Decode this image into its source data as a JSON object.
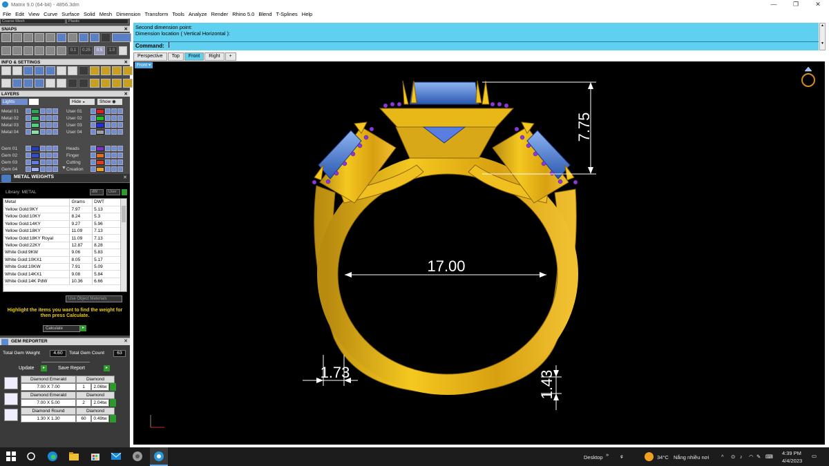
{
  "window": {
    "title": "Matrix 9.0 (64-bit) - 4856.3dm",
    "controls": [
      "—",
      "❐",
      "✕"
    ]
  },
  "menu": [
    "File",
    "Edit",
    "View",
    "Curve",
    "Surface",
    "Solid",
    "Mesh",
    "Dimension",
    "Transform",
    "Tools",
    "Analyze",
    "Render",
    "Rhino 5.0",
    "Blend",
    "T-Splines",
    "Help"
  ],
  "display_combos": {
    "mesh": "Coarse Mesh",
    "material": "Plastic"
  },
  "panels": {
    "snaps": "SNAPS",
    "info": "INFO & SETTINGS",
    "layers": "LAYERS",
    "metal_weights": "METAL WEIGHTS",
    "gem_reporter": "GEM REPORTER"
  },
  "snap_values": [
    "0.1",
    "0.25",
    "0.5",
    "1.0"
  ],
  "layers": {
    "lights_label": "Lights",
    "hide_label": "Hide",
    "show_label": "Show",
    "left": [
      {
        "name": "Metal 01",
        "color": "#2fa85a"
      },
      {
        "name": "Metal 02",
        "color": "#3ec46c"
      },
      {
        "name": "Metal 03",
        "color": "#4fd07a"
      },
      {
        "name": "Metal 04",
        "color": "#8fe0a0"
      },
      {
        "name": "Gem 01",
        "color": "#1f3fbf"
      },
      {
        "name": "Gem 02",
        "color": "#2f4fd0"
      },
      {
        "name": "Gem 03",
        "color": "#5f7fe0"
      },
      {
        "name": "Gem 04",
        "color": "#9fb4ee"
      }
    ],
    "right": [
      {
        "name": "User 01",
        "color": "#e02020"
      },
      {
        "name": "User 02",
        "color": "#20c020"
      },
      {
        "name": "User 03",
        "color": "#2030e0"
      },
      {
        "name": "User 04",
        "color": "#a0a0a0"
      },
      {
        "name": "Heads",
        "color": "#8030c0"
      },
      {
        "name": "Finger",
        "color": "#e07020"
      },
      {
        "name": "Cutting",
        "color": "#e04020"
      },
      {
        "name": "Creation",
        "color": "#f0a020"
      }
    ]
  },
  "metal_weights": {
    "library_label": "Library: METAL",
    "dw_label": "dW",
    "user_label": "User",
    "columns": [
      "Metal",
      "Grams",
      "DWT"
    ],
    "rows": [
      [
        "Yellow Gold:9KY",
        "7.97",
        "5.13"
      ],
      [
        "Yellow Gold:10KY",
        "8.24",
        "5.3"
      ],
      [
        "Yellow Gold:14KY",
        "9.27",
        "5.96"
      ],
      [
        "Yellow Gold:18KY",
        "11.09",
        "7.13"
      ],
      [
        "Yellow Gold:18KY Royal",
        "11.09",
        "7.13"
      ],
      [
        "Yellow Gold:22KY",
        "12.87",
        "8.28"
      ],
      [
        "White Gold:9KW",
        "9.06",
        "5.83"
      ],
      [
        "White Gold:10KX1",
        "8.05",
        "5.17"
      ],
      [
        "White Gold:10KW",
        "7.91",
        "5.09"
      ],
      [
        "White Gold:14KX1",
        "9.08",
        "5.84"
      ],
      [
        "White Gold:14K PdW",
        "10.36",
        "6.66"
      ]
    ],
    "use_object_materials": "Use Object Materials",
    "hint": "Highlight the items you want to find the weight for then press Calculate.",
    "calculate": "Calculate"
  },
  "gem_reporter": {
    "total_weight_label": "Total Gem Weight",
    "total_weight": "4.60",
    "total_count_label": "Total Gem Count",
    "total_count": "63",
    "update_label": "Update",
    "save_label": "Save Report",
    "gems": [
      {
        "shape": "Diamond Emerald",
        "size": "7.00 X 7.00",
        "material": "Diamond",
        "qty": "1",
        "ctw": "2.06tw"
      },
      {
        "shape": "Diamond Emerald",
        "size": "7.00 X 5.00",
        "material": "Diamond",
        "qty": "2",
        "ctw": "2.04tw"
      },
      {
        "shape": "Diamond Round",
        "size": "1.30 X 1.30",
        "material": "Diamond",
        "qty": "60",
        "ctw": "0.49tw"
      }
    ]
  },
  "command": {
    "line1": "Second dimension point:",
    "line2": "Dimension location ( Vertical  Horizontal ):",
    "prompt_label": "Command:"
  },
  "viewport": {
    "tabs": [
      "Perspective",
      "Top",
      "Front",
      "Right",
      "+"
    ],
    "active_tab": "Front",
    "name_label": "Front",
    "dimensions": {
      "top_height": "7.75",
      "inner_diameter": "17.00",
      "shank_width": "1.73",
      "shank_thickness": "1.43"
    }
  },
  "taskbar": {
    "desktop_label": "Desktop",
    "weather_temp": "34°C",
    "weather_text": "Nắng nhiều nơi",
    "time": "4:39 PM",
    "date": "4/4/2023"
  }
}
